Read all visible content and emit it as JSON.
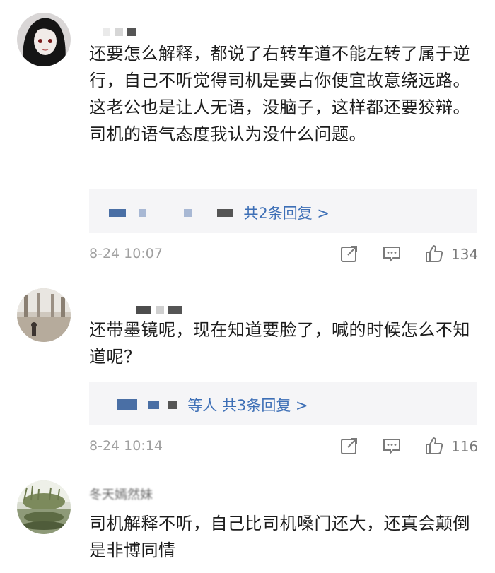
{
  "comments": [
    {
      "text": "还要怎么解释，都说了右转车道不能左转了属于逆行，自己不听觉得司机是要占你便宜故意绕远路。这老公也是让人无语，没脑子，这样都还要狡辩。司机的语气态度我认为没什么问题。",
      "reply_link": "共2条回复 >",
      "time": "8-24 10:07",
      "likes": "134"
    },
    {
      "text": "还带墨镜呢，现在知道要脸了，喊的时候怎么不知道呢？",
      "reply_link": "等人 共3条回复 >",
      "time": "8-24 10:14",
      "likes": "116"
    },
    {
      "name": "冬天嫣然妹",
      "text": "司机解释不听，自己比司机嗓门还大，还真会颠倒是非博同情"
    }
  ],
  "icons": [
    "share-icon",
    "comment-icon",
    "like-icon"
  ],
  "colors": {
    "link": "#3d6fb6",
    "meta": "#a0a0a0",
    "reply_bg": "#f5f5f7"
  }
}
